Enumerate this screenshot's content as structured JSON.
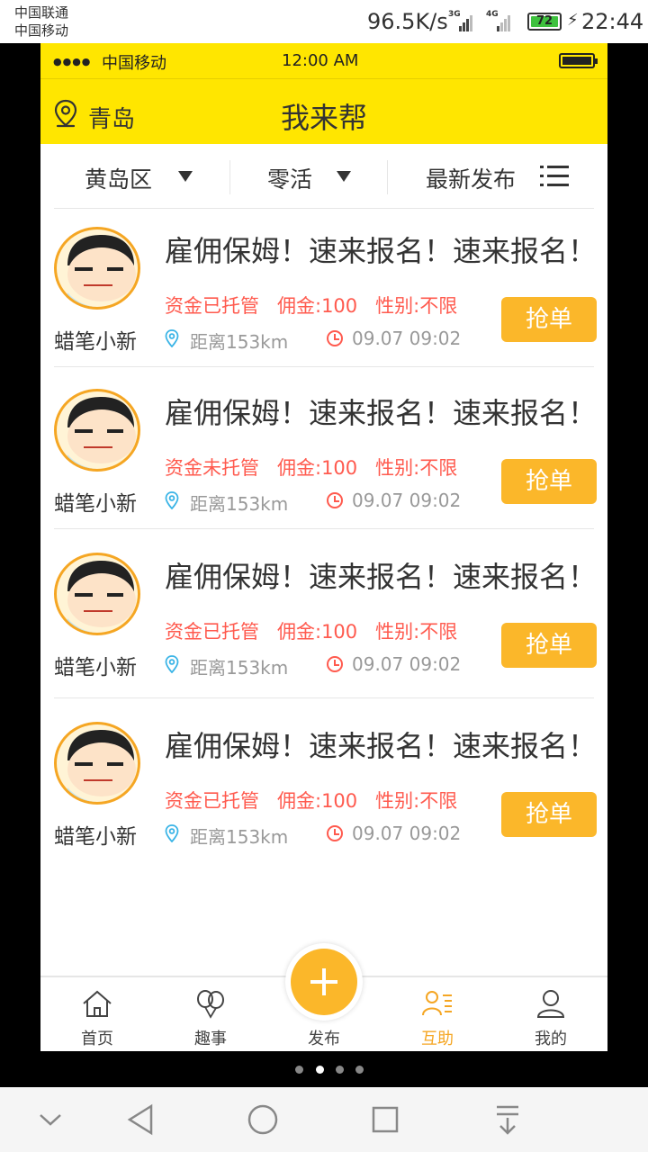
{
  "android_status": {
    "carrier1": "中国联通",
    "carrier2": "中国移动",
    "speed": "96.5K/s",
    "net1": "3G",
    "net2": "4G",
    "battery": "72",
    "time": "22:44"
  },
  "ios_status": {
    "carrier": "中国移动",
    "time": "12:00 AM"
  },
  "header": {
    "city": "青岛",
    "title": "我来帮"
  },
  "filters": {
    "district": "黄岛区",
    "category": "零活",
    "sort": "最新发布"
  },
  "posts": [
    {
      "user": "蜡笔小新",
      "title": "雇佣保姆！速来报名！速来报名！",
      "fund": "资金已托管",
      "commission": "佣金:100",
      "gender": "性别:不限",
      "distance": "距离153km",
      "date": "09.07  09:02",
      "button": "抢单"
    },
    {
      "user": "蜡笔小新",
      "title": "雇佣保姆！速来报名！速来报名！",
      "fund": "资金未托管",
      "commission": "佣金:100",
      "gender": "性别:不限",
      "distance": "距离153km",
      "date": "09.07  09:02",
      "button": "抢单"
    },
    {
      "user": "蜡笔小新",
      "title": "雇佣保姆！速来报名！速来报名！",
      "fund": "资金已托管",
      "commission": "佣金:100",
      "gender": "性别:不限",
      "distance": "距离153km",
      "date": "09.07  09:02",
      "button": "抢单"
    },
    {
      "user": "蜡笔小新",
      "title": "雇佣保姆！速来报名！速来报名！",
      "fund": "资金已托管",
      "commission": "佣金:100",
      "gender": "性别:不限",
      "distance": "距离153km",
      "date": "09.07  09:02",
      "button": "抢单"
    }
  ],
  "tabs": [
    {
      "label": "首页",
      "icon": "home-icon"
    },
    {
      "label": "趣事",
      "icon": "balloons-icon"
    },
    {
      "label": "发布",
      "icon": "plus-icon"
    },
    {
      "label": "互助",
      "icon": "people-list-icon",
      "active": true
    },
    {
      "label": "我的",
      "icon": "user-icon"
    }
  ],
  "colors": {
    "brand_yellow": "#ffe600",
    "accent_orange": "#fbb72a",
    "tag_red": "#ff5a4e"
  }
}
